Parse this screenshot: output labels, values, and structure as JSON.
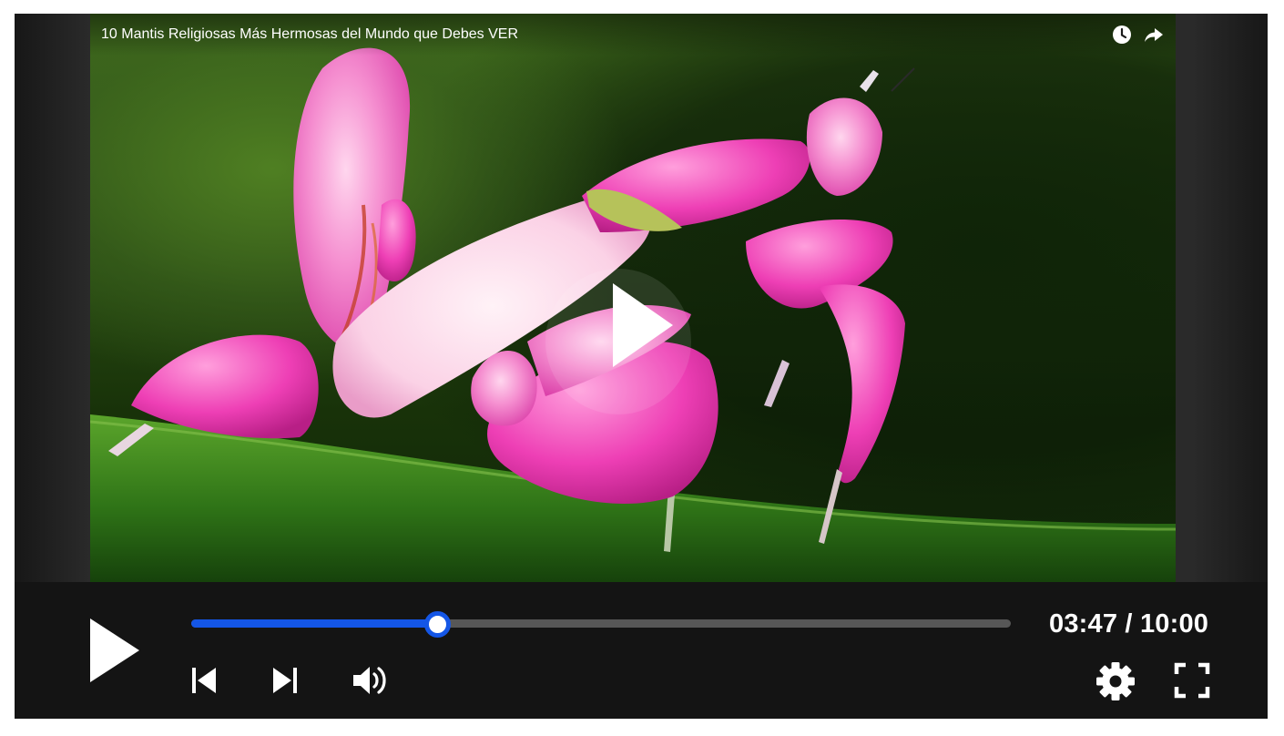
{
  "video": {
    "title": "10 Mantis Religiosas Más Hermosas del Mundo que Debes VER"
  },
  "controls": {
    "current_time": "03:47",
    "duration": "10:00",
    "time_separator": " / ",
    "progress_fraction": 0.3
  },
  "colors": {
    "accent": "#1456e6",
    "control_bar": "#141414",
    "track": "#575757"
  },
  "icons": {
    "watch_later": "clock-icon",
    "share": "share-arrow-icon",
    "big_play": "play-icon",
    "play": "play-icon",
    "previous": "skip-previous-icon",
    "next": "skip-next-icon",
    "volume": "volume-icon",
    "settings": "gear-icon",
    "fullscreen": "fullscreen-icon"
  }
}
